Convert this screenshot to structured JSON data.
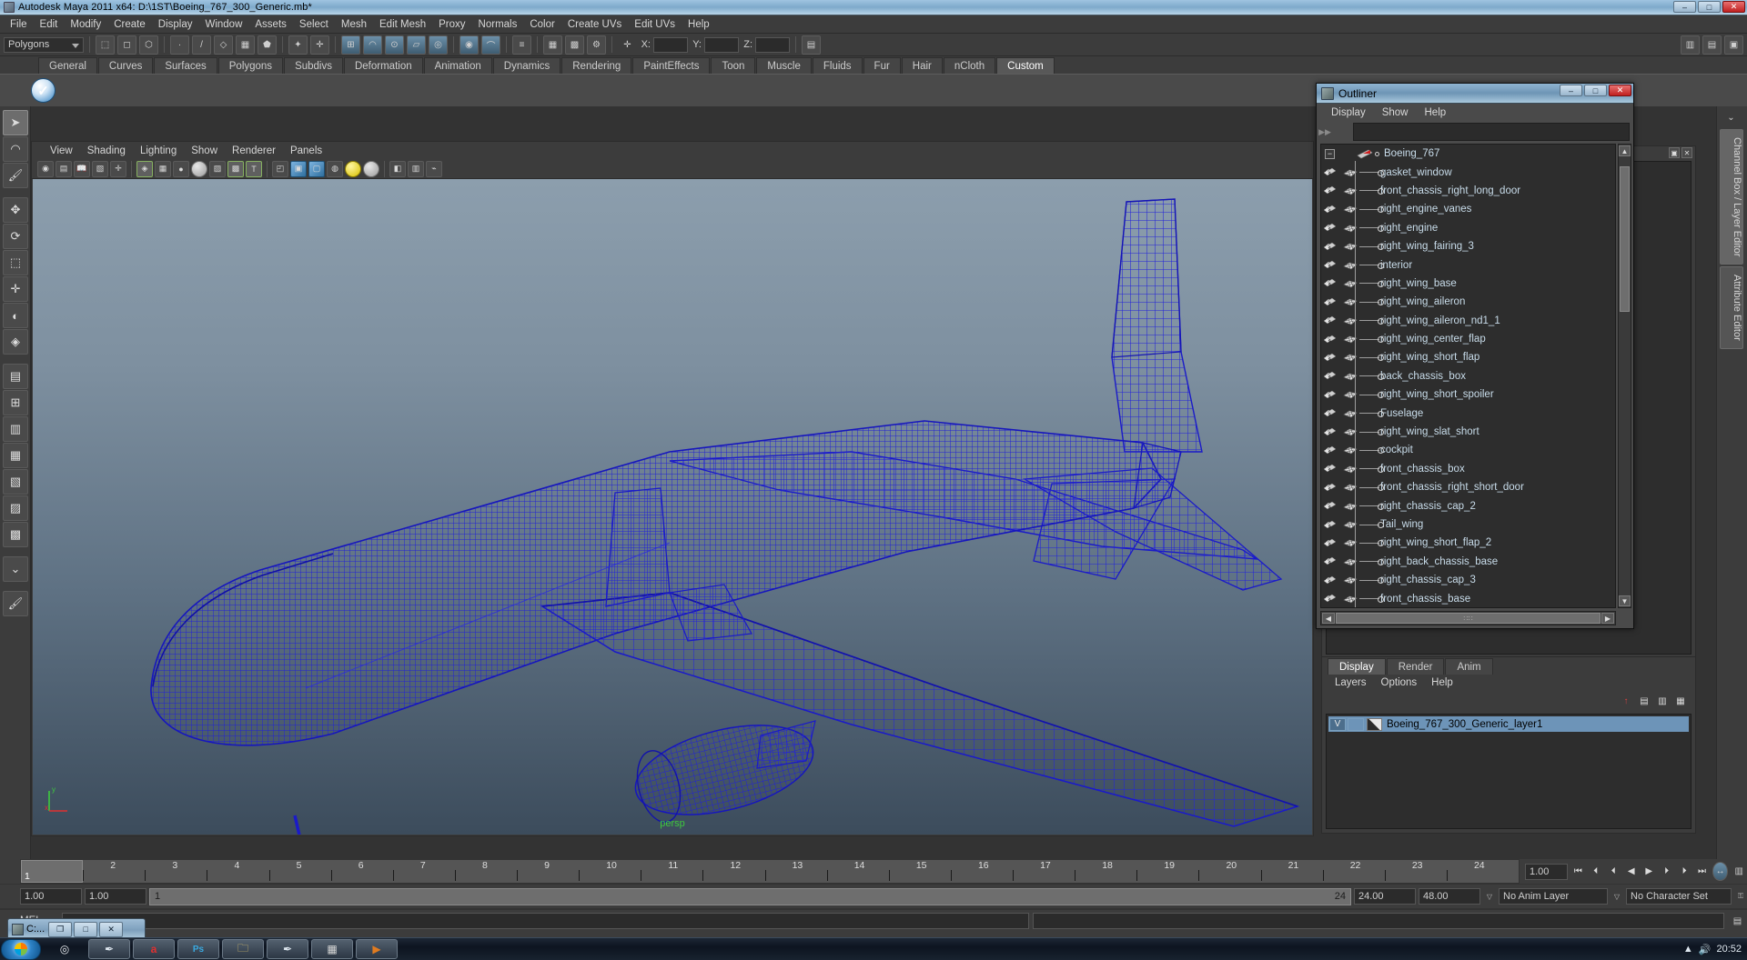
{
  "window": {
    "title": "Autodesk Maya 2011 x64: D:\\1ST\\Boeing_767_300_Generic.mb*",
    "icon": "maya-app-icon",
    "buttons": {
      "minimize": "–",
      "maximize": "□",
      "close": "✕"
    }
  },
  "menubar": [
    {
      "label": "File"
    },
    {
      "label": "Edit"
    },
    {
      "label": "Modify"
    },
    {
      "label": "Create"
    },
    {
      "label": "Display"
    },
    {
      "label": "Window"
    },
    {
      "label": "Assets"
    },
    {
      "label": "Select"
    },
    {
      "label": "Mesh"
    },
    {
      "label": "Edit Mesh"
    },
    {
      "label": "Proxy"
    },
    {
      "label": "Normals"
    },
    {
      "label": "Color"
    },
    {
      "label": "Create UVs"
    },
    {
      "label": "Edit UVs"
    },
    {
      "label": "Help"
    }
  ],
  "statusline": {
    "mode_selected": "Polygons",
    "coord_labels": [
      "X:",
      "Y:",
      "Z:"
    ],
    "coord_values": [
      "",
      "",
      ""
    ]
  },
  "shelf": {
    "tabs": [
      {
        "label": "General"
      },
      {
        "label": "Curves"
      },
      {
        "label": "Surfaces"
      },
      {
        "label": "Polygons"
      },
      {
        "label": "Subdivs"
      },
      {
        "label": "Deformation"
      },
      {
        "label": "Animation"
      },
      {
        "label": "Dynamics"
      },
      {
        "label": "Rendering"
      },
      {
        "label": "PaintEffects"
      },
      {
        "label": "Toon"
      },
      {
        "label": "Muscle"
      },
      {
        "label": "Fluids"
      },
      {
        "label": "Fur"
      },
      {
        "label": "Hair"
      },
      {
        "label": "nCloth"
      },
      {
        "label": "Custom"
      }
    ],
    "active_tab": "Custom",
    "item_icon": "checkmark-shelf-icon"
  },
  "viewport": {
    "menus": [
      {
        "label": "View"
      },
      {
        "label": "Shading"
      },
      {
        "label": "Lighting"
      },
      {
        "label": "Show"
      },
      {
        "label": "Renderer"
      },
      {
        "label": "Panels"
      }
    ],
    "camera_label": "persp",
    "axis": {
      "y": "y",
      "x": "x"
    },
    "model_description": "Boeing 767 wireframe airliner shown in blue wireframe on gradient background"
  },
  "right_dock_tabs": [
    {
      "label": "Channel Box / Layer Editor",
      "active": true
    },
    {
      "label": "Attribute Editor",
      "active": false
    }
  ],
  "outliner": {
    "title": "Outliner",
    "icon": "maya-app-icon",
    "window_buttons": {
      "minimize": "–",
      "maximize": "□",
      "close": "✕"
    },
    "menus": [
      {
        "label": "Display"
      },
      {
        "label": "Show"
      },
      {
        "label": "Help"
      }
    ],
    "search_value": "",
    "root": {
      "label": "Boeing_767",
      "expander": "−",
      "icon": "transform-node-icon"
    },
    "items": [
      {
        "label": "gasket_window"
      },
      {
        "label": "front_chassis_right_long_door"
      },
      {
        "label": "right_engine_vanes"
      },
      {
        "label": "right_engine"
      },
      {
        "label": "right_wing_fairing_3"
      },
      {
        "label": "interior"
      },
      {
        "label": "right_wing_base"
      },
      {
        "label": "right_wing_aileron"
      },
      {
        "label": "right_wing_aileron_nd1_1"
      },
      {
        "label": "right_wing_center_flap"
      },
      {
        "label": "right_wing_short_flap"
      },
      {
        "label": "back_chassis_box"
      },
      {
        "label": "right_wing_short_spoiler"
      },
      {
        "label": "Fuselage"
      },
      {
        "label": "right_wing_slat_short"
      },
      {
        "label": "cockpit"
      },
      {
        "label": "front_chassis_box"
      },
      {
        "label": "front_chassis_right_short_door"
      },
      {
        "label": "right_chassis_cap_2"
      },
      {
        "label": "Tail_wing"
      },
      {
        "label": "right_wing_short_flap_2"
      },
      {
        "label": "right_back_chassis_base"
      },
      {
        "label": "right_chassis_cap_3"
      },
      {
        "label": "front_chassis_base"
      }
    ]
  },
  "layer_editor": {
    "tabs": [
      {
        "label": "Display",
        "active": true
      },
      {
        "label": "Render",
        "active": false
      },
      {
        "label": "Anim",
        "active": false
      }
    ],
    "menus": [
      {
        "label": "Layers"
      },
      {
        "label": "Options"
      },
      {
        "label": "Help"
      }
    ],
    "layers": [
      {
        "visibility": "V",
        "playback": "",
        "name": "Boeing_767_300_Generic_layer1",
        "selected": true
      }
    ]
  },
  "timeline": {
    "frame_numbers": [
      "1",
      "2",
      "3",
      "4",
      "5",
      "6",
      "7",
      "8",
      "9",
      "10",
      "11",
      "12",
      "13",
      "14",
      "15",
      "16",
      "17",
      "18",
      "19",
      "20",
      "21",
      "22",
      "23",
      "24"
    ],
    "current_frame_label": "1",
    "current_time_field": "1.00",
    "playback_buttons": [
      {
        "name": "go-to-start-icon",
        "glyph": "⏮"
      },
      {
        "name": "step-back-keyframe-icon",
        "glyph": "⏴"
      },
      {
        "name": "step-back-frame-icon",
        "glyph": "⏴"
      },
      {
        "name": "play-backwards-icon",
        "glyph": "◀"
      },
      {
        "name": "play-forwards-icon",
        "glyph": "▶"
      },
      {
        "name": "step-forward-frame-icon",
        "glyph": "⏵"
      },
      {
        "name": "step-forward-keyframe-icon",
        "glyph": "⏵"
      },
      {
        "name": "go-to-end-icon",
        "glyph": "⏭"
      }
    ]
  },
  "range_slider": {
    "anim_start": "1.00",
    "range_start": "1.00",
    "bar_start_label": "1",
    "bar_end_label": "24",
    "range_end": "24.00",
    "anim_end": "48.00",
    "anim_layer": "No Anim Layer",
    "character_set": "No Character Set"
  },
  "command_line": {
    "label": "MEL",
    "input_value": "",
    "output_value": ""
  },
  "mini_window": {
    "title": "C:...",
    "buttons": {
      "restore": "❐",
      "maximize": "□",
      "close": "✕"
    }
  },
  "taskbar": {
    "start": "windows-start-orb",
    "items": [
      {
        "name": "taskbar-chrome-icon",
        "glyph": "◎"
      },
      {
        "name": "taskbar-maya-icon",
        "glyph": "✒"
      },
      {
        "name": "taskbar-acrobat-icon",
        "glyph": "a"
      },
      {
        "name": "taskbar-photoshop-icon",
        "glyph": "Ps"
      },
      {
        "name": "taskbar-explorer-icon",
        "glyph": "⬜"
      },
      {
        "name": "taskbar-maya-window-icon",
        "glyph": "✒"
      },
      {
        "name": "taskbar-folder-icon",
        "glyph": "⬛"
      },
      {
        "name": "taskbar-app-icon",
        "glyph": "■"
      },
      {
        "name": "taskbar-orange-icon",
        "glyph": "▶"
      }
    ],
    "clock": "20:52"
  },
  "colors": {
    "wireframe": "#1a1acd",
    "titlebar": "#8fb4d2",
    "panel_bg": "#3c3c3c",
    "list_bg": "#2d2d2d",
    "selection": "#6d94b8",
    "camera_label": "#3ec93e"
  }
}
